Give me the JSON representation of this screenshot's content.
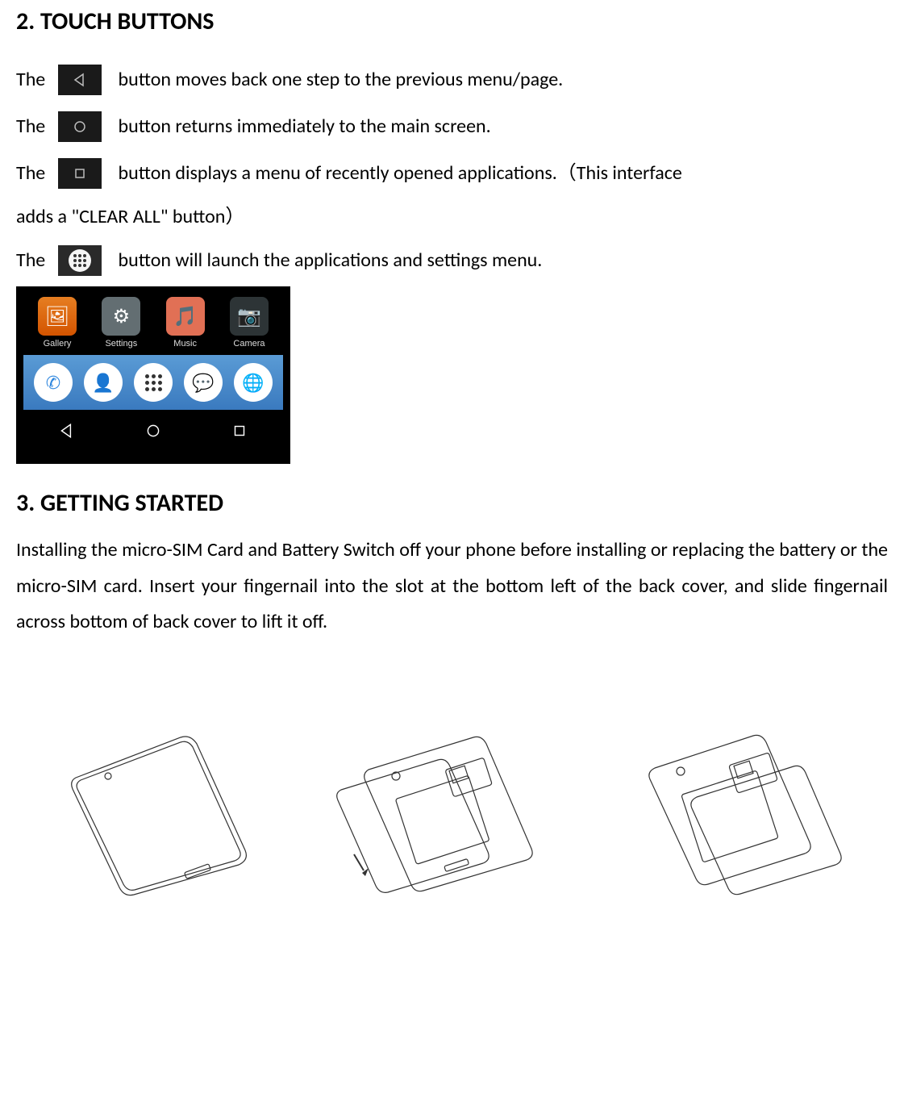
{
  "section_touch": {
    "heading": "2. TOUCH BUTTONS",
    "lines": {
      "back": {
        "pre": "The ",
        "post": "  button moves back one step to the previous menu/page."
      },
      "home": {
        "pre": "The ",
        "post": "  button returns immediately to the main screen."
      },
      "recent": {
        "pre": "The ",
        "post": "  button displays a menu of recently opened applications.（This interface "
      },
      "recent_cont": "adds a \"CLEAR ALL\" button）",
      "apps": {
        "pre": "The ",
        "post": "  button will launch the applications and settings menu."
      }
    },
    "phone": {
      "app_labels": [
        "Gallery",
        "Settings",
        "Music",
        "Camera"
      ],
      "nav_icons": [
        "back-triangle",
        "home-circle",
        "recent-square"
      ]
    }
  },
  "section_started": {
    "heading": "3. GETTING STARTED",
    "paragraph": "Installing the micro-SIM Card and Battery Switch off your phone before installing or replacing the battery or the micro-SIM card. Insert your fingernail into the slot at the bottom left of the back cover, and slide fingernail across bottom of back cover to lift it off."
  }
}
